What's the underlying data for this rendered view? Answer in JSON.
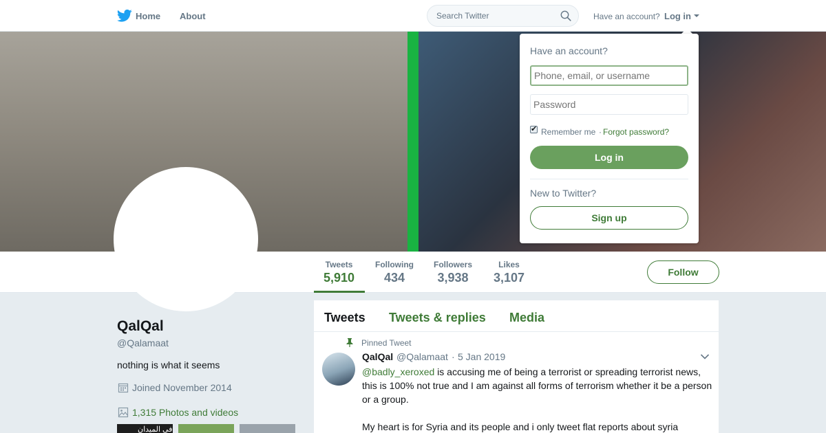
{
  "colors": {
    "accent": "#3f7b37",
    "button_fill": "#6aa05e",
    "brand_blue": "#1da1f2",
    "muted_text": "#657786"
  },
  "topnav": {
    "logo_icon": "bird-icon",
    "home_label": "Home",
    "home_icon": "bird-icon",
    "about_label": "About",
    "search_placeholder": "Search Twitter",
    "search_icon": "search-icon",
    "have_account": "Have an account?",
    "login_label": "Log in"
  },
  "profile_nav": {
    "stats": [
      {
        "label": "Tweets",
        "value": "5,910",
        "active": true
      },
      {
        "label": "Following",
        "value": "434"
      },
      {
        "label": "Followers",
        "value": "3,938"
      },
      {
        "label": "Likes",
        "value": "3,107"
      }
    ],
    "follow_label": "Follow"
  },
  "profile": {
    "name": "QalQal",
    "handle": "@Qalamaat",
    "bio": "nothing is what it seems",
    "joined": "Joined November 2014",
    "photos": "1,315 Photos and videos",
    "thumb1_text": "في الميدان"
  },
  "timeline": {
    "tabs": [
      "Tweets",
      "Tweets & replies",
      "Media"
    ],
    "pinned_label": "Pinned Tweet",
    "tweet": {
      "name": "QalQal",
      "handle": "@Qalamaat",
      "separator": "·",
      "date": "5 Jan 2019",
      "mention": "@badly_xeroxed",
      "text_rest": " is accusing me of being a terrorist or spreading terrorist news, this is 100% not true and I am against all forms of terrorism whether it be a person or a group.",
      "text2": "My heart is for Syria and its people and i only tweet flat reports about syria"
    }
  },
  "login_dropdown": {
    "title": "Have an account?",
    "username_placeholder": "Phone, email, or username",
    "password_placeholder": "Password",
    "remember_label": "Remember me",
    "separator": "·",
    "forgot_label": "Forgot password?",
    "login_button": "Log in",
    "new_label": "New to Twitter?",
    "signup_button": "Sign up"
  }
}
